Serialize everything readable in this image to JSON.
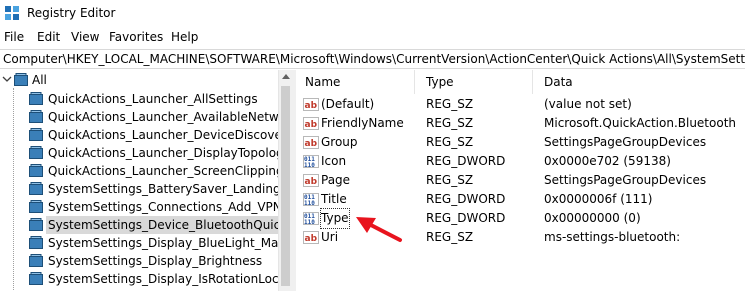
{
  "window": {
    "title": "Registry Editor"
  },
  "menu": [
    "File",
    "Edit",
    "View",
    "Favorites",
    "Help"
  ],
  "address": {
    "path": "Computer\\HKEY_LOCAL_MACHINE\\SOFTWARE\\Microsoft\\Windows\\CurrentVersion\\ActionCenter\\Quick Actions\\All\\SystemSettings_Device"
  },
  "tree": {
    "root": "All",
    "items": [
      {
        "label": "QuickActions_Launcher_AllSettings"
      },
      {
        "label": "QuickActions_Launcher_AvailableNetworks"
      },
      {
        "label": "QuickActions_Launcher_DeviceDiscovery"
      },
      {
        "label": "QuickActions_Launcher_DisplayTopology"
      },
      {
        "label": "QuickActions_Launcher_ScreenClipping"
      },
      {
        "label": "SystemSettings_BatterySaver_LandingPage_"
      },
      {
        "label": "SystemSettings_Connections_Add_VPN"
      },
      {
        "label": "SystemSettings_Device_BluetoothQuickAct",
        "selected": true
      },
      {
        "label": "SystemSettings_Display_BlueLight_ManualT"
      },
      {
        "label": "SystemSettings_Display_Brightness"
      },
      {
        "label": "SystemSettings_Display_IsRotationLockedC"
      }
    ]
  },
  "list": {
    "columns": [
      "Name",
      "Type",
      "Data"
    ],
    "rows": [
      {
        "icon": "string-value-icon",
        "name": "(Default)",
        "type": "REG_SZ",
        "data": "(value not set)"
      },
      {
        "icon": "string-value-icon",
        "name": "FriendlyName",
        "type": "REG_SZ",
        "data": "Microsoft.QuickAction.Bluetooth"
      },
      {
        "icon": "string-value-icon",
        "name": "Group",
        "type": "REG_SZ",
        "data": "SettingsPageGroupDevices"
      },
      {
        "icon": "dword-value-icon",
        "name": "Icon",
        "type": "REG_DWORD",
        "data": "0x0000e702 (59138)"
      },
      {
        "icon": "string-value-icon",
        "name": "Page",
        "type": "REG_SZ",
        "data": "SettingsPageGroupDevices"
      },
      {
        "icon": "dword-value-icon",
        "name": "Title",
        "type": "REG_DWORD",
        "data": "0x0000006f (111)"
      },
      {
        "icon": "dword-value-icon",
        "name": "Type",
        "type": "REG_DWORD",
        "data": "0x00000000 (0)",
        "focused": true
      },
      {
        "icon": "string-value-icon",
        "name": "Uri",
        "type": "REG_SZ",
        "data": "ms-settings-bluetooth:"
      }
    ]
  },
  "annotation": {
    "color": "#e8141e"
  }
}
